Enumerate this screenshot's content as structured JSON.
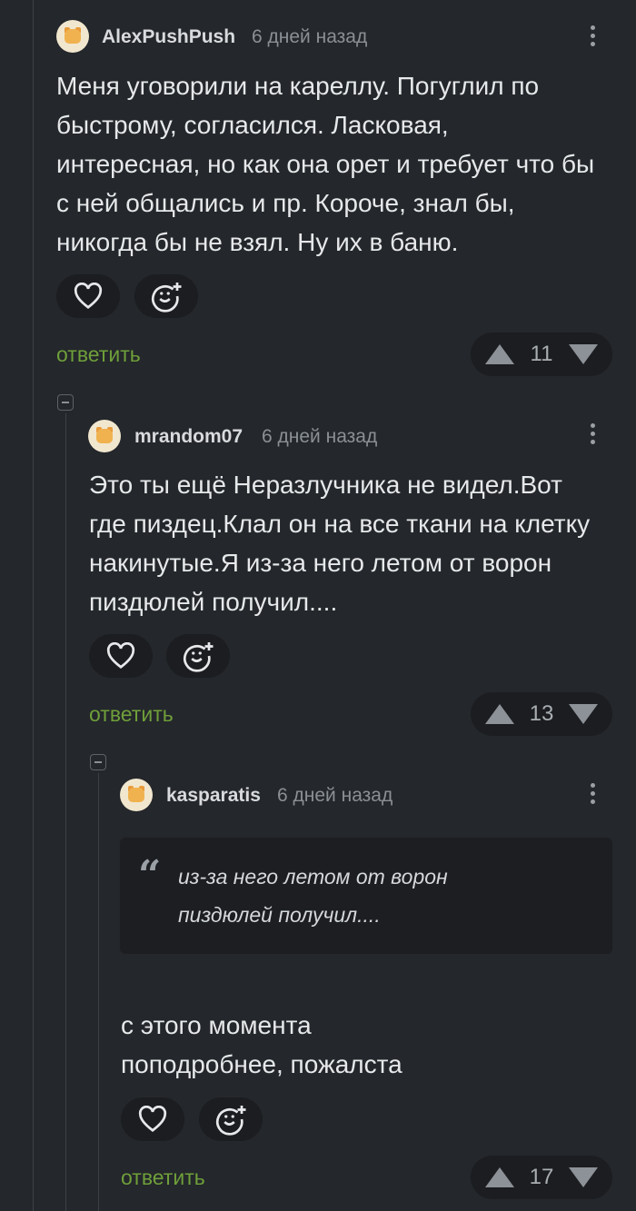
{
  "comments": [
    {
      "username": "AlexPushPush",
      "time": "6 дней назад",
      "text": [
        "Меня уговорили на кареллу. Погуглил по",
        "быстрому, согласился. Ласковая,",
        "интересная, но как она орет и требует что бы",
        "с ней общались и пр. Короче, знал бы,",
        "никогда бы не взял. Ну их в баню."
      ],
      "reply_label": "ответить",
      "rating": "11"
    },
    {
      "username": "mrandom07",
      "time": "6 дней назад",
      "text": [
        "Это ты ещё Неразлучника не видел.Вот",
        "где пиздец.Клал он на все ткани на клетку",
        "накинутые.Я из-за него летом от ворон",
        "пиздюлей получил...."
      ],
      "reply_label": "ответить",
      "rating": "13"
    },
    {
      "username": "kasparatis",
      "time": "6 дней назад",
      "quote": [
        "из-за него летом от ворон",
        "пиздюлей получил...."
      ],
      "text": [
        "с этого момента",
        "поподробнее, пожалста"
      ],
      "reply_label": "ответить",
      "rating": "17"
    }
  ],
  "icons": {
    "like": "heart-icon",
    "reaction": "smile-plus-icon",
    "menu": "more-vertical-icon",
    "upvote": "triangle-up-icon",
    "downvote": "triangle-down-icon"
  },
  "colors": {
    "background": "#24272b",
    "reply": "#6f9f3a",
    "pill": "#1b1d20"
  }
}
